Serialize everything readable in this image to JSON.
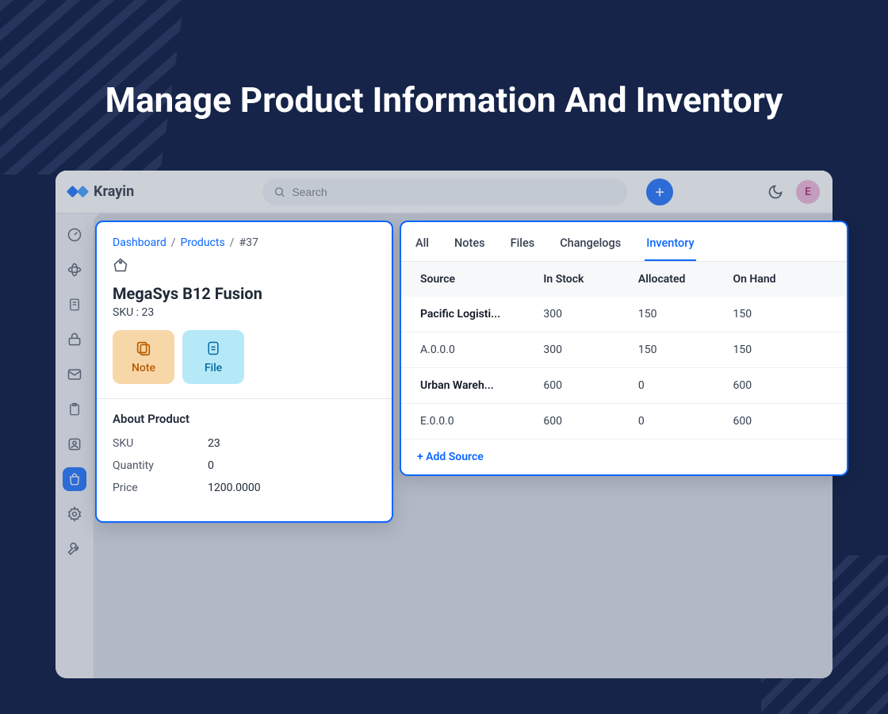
{
  "hero": {
    "title": "Manage Product Information And Inventory"
  },
  "brand": {
    "name": "Krayin"
  },
  "search": {
    "placeholder": "Search"
  },
  "avatar": {
    "initial": "E"
  },
  "breadcrumb": {
    "dashboard": "Dashboard",
    "products": "Products",
    "current": "#37"
  },
  "product": {
    "name": "MegaSys B12 Fusion",
    "sku_label": "SKU : 23",
    "note_btn": "Note",
    "file_btn": "File",
    "about_heading": "About Product",
    "fields": {
      "sku": {
        "label": "SKU",
        "value": "23"
      },
      "quantity": {
        "label": "Quantity",
        "value": "0"
      },
      "price": {
        "label": "Price",
        "value": "1200.0000"
      }
    }
  },
  "tabs": {
    "all": "All",
    "notes": "Notes",
    "files": "Files",
    "changelogs": "Changelogs",
    "inventory": "Inventory"
  },
  "inventory": {
    "headers": {
      "source": "Source",
      "in_stock": "In Stock",
      "allocated": "Allocated",
      "on_hand": "On Hand"
    },
    "rows": [
      {
        "source": "Pacific Logisti...",
        "in_stock": "300",
        "allocated": "150",
        "on_hand": "150",
        "sub": false
      },
      {
        "source": "A.0.0.0",
        "in_stock": "300",
        "allocated": "150",
        "on_hand": "150",
        "sub": true
      },
      {
        "source": "Urban Wareh...",
        "in_stock": "600",
        "allocated": "0",
        "on_hand": "600",
        "sub": false
      },
      {
        "source": "E.0.0.0",
        "in_stock": "600",
        "allocated": "0",
        "on_hand": "600",
        "sub": true
      }
    ],
    "add_source": "+ Add Source"
  }
}
